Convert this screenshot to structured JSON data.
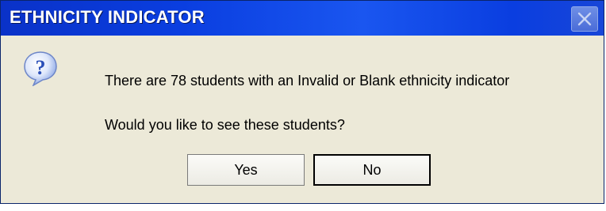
{
  "window": {
    "title": "ETHNICITY INDICATOR",
    "close_icon": "close-icon"
  },
  "dialog": {
    "icon": "question-icon",
    "message_line1": "There are 78 students with an Invalid or Blank ethnicity indicator",
    "message_line2": "Would you like to see these students?"
  },
  "buttons": {
    "yes_label": "Yes",
    "no_label": "No"
  },
  "colors": {
    "titlebar": "#0a3ee0",
    "dialog_bg": "#ece9d8",
    "icon_blue": "#2a5fd8"
  }
}
